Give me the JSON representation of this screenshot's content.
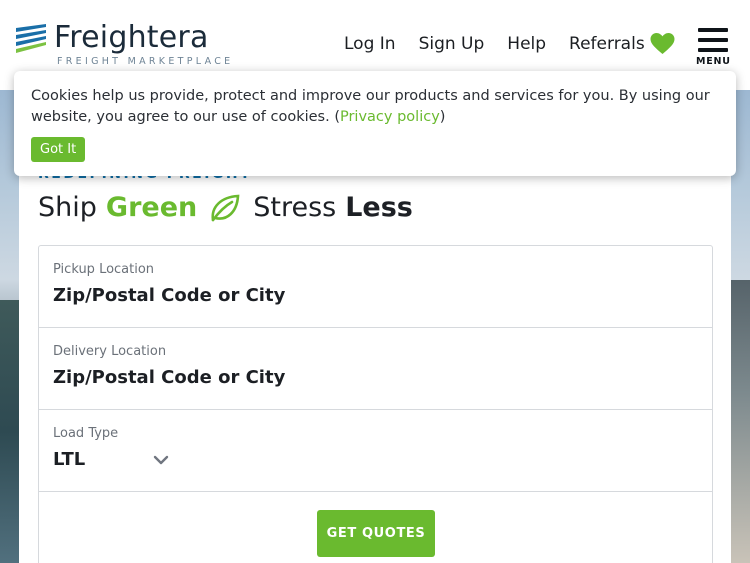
{
  "brand": {
    "name": "Freightera",
    "tagline": "FREIGHT MARKETPLACE"
  },
  "nav": {
    "login": "Log In",
    "signup": "Sign Up",
    "help": "Help",
    "referrals": "Referrals",
    "menu_label": "MENU"
  },
  "cookie_banner": {
    "text_before": "Cookies help us provide, protect and improve our products and services for you. By using our website, you agree to our use of cookies. (",
    "privacy_link": "Privacy policy",
    "text_after": ")",
    "button": "Got It"
  },
  "hero": {
    "eyebrow": "REDEFINING FREIGHT",
    "headline_part1": "Ship",
    "headline_green": "Green",
    "headline_part2": "Stress",
    "headline_bold": "Less"
  },
  "form": {
    "pickup_label": "Pickup Location",
    "pickup_placeholder": "Zip/Postal Code or City",
    "delivery_label": "Delivery Location",
    "delivery_placeholder": "Zip/Postal Code or City",
    "load_type_label": "Load Type",
    "load_type_value": "LTL",
    "submit": "GET QUOTES"
  },
  "colors": {
    "brand_green": "#6aba2f",
    "brand_blue": "#0f6fa8",
    "logo_dark": "#1b2b3a"
  }
}
